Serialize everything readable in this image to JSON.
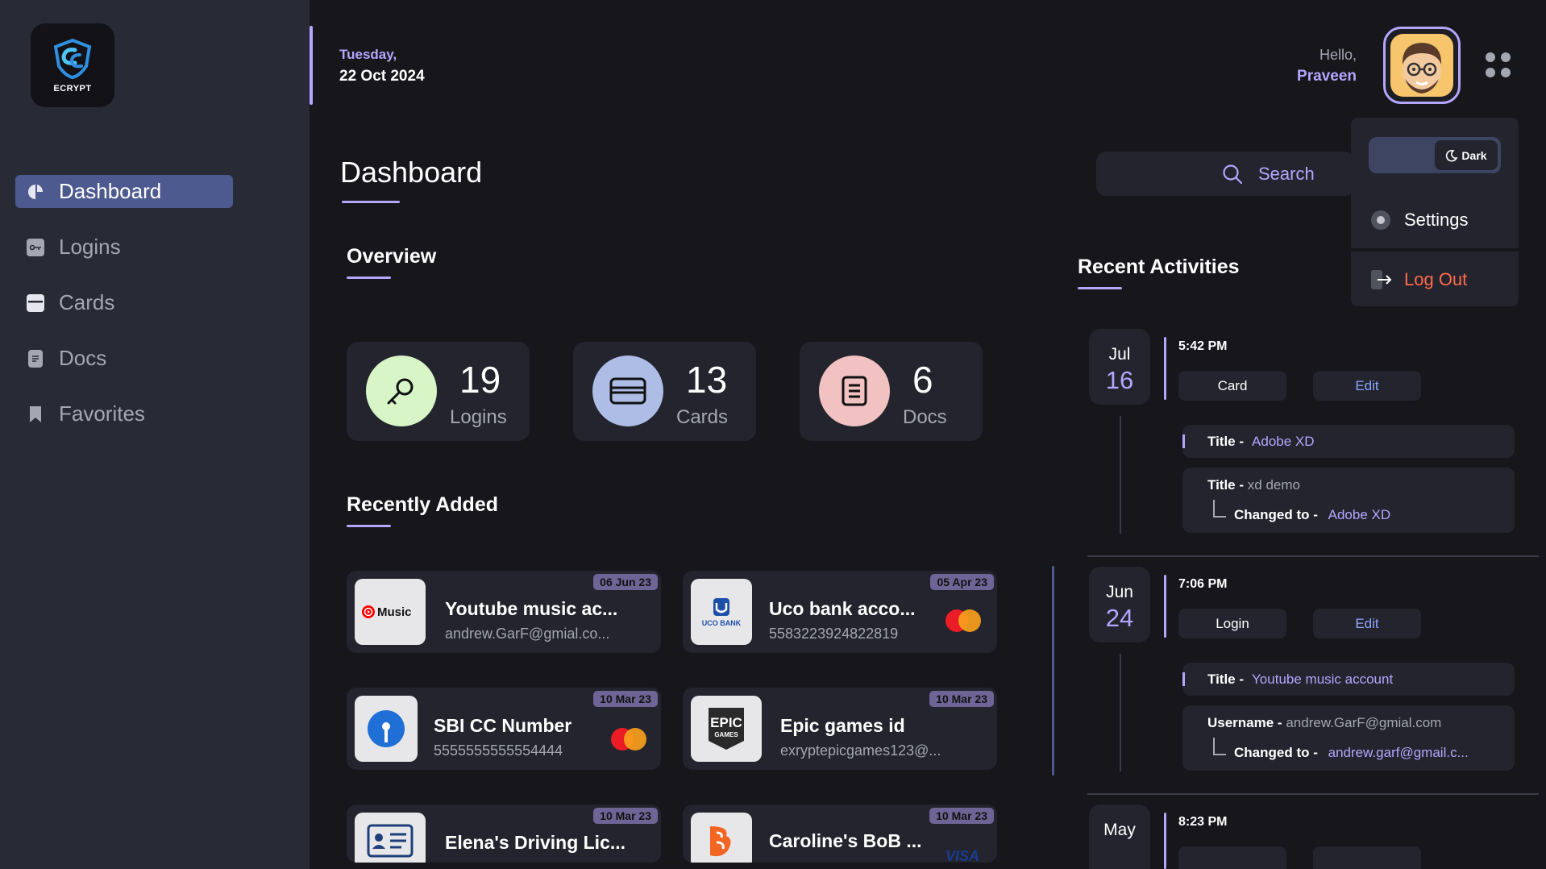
{
  "app": {
    "logo_text": "ECRYPT"
  },
  "sidebar": {
    "items": [
      {
        "label": "Dashboard",
        "icon": "dashboard-icon",
        "active": true
      },
      {
        "label": "Logins",
        "icon": "key-icon"
      },
      {
        "label": "Cards",
        "icon": "card-icon"
      },
      {
        "label": "Docs",
        "icon": "doc-icon"
      },
      {
        "label": "Favorites",
        "icon": "bookmark-icon"
      }
    ]
  },
  "header": {
    "day": "Tuesday,",
    "date": "22 Oct 2024",
    "greeting": "Hello,",
    "user_name": "Praveen"
  },
  "page_title": "Dashboard",
  "search": {
    "label": "Search"
  },
  "dropdown": {
    "theme_label": "Dark",
    "settings_label": "Settings",
    "logout_label": "Log Out"
  },
  "overview": {
    "title": "Overview",
    "stats": [
      {
        "value": "19",
        "label": "Logins",
        "color": "#d7f5c6"
      },
      {
        "value": "13",
        "label": "Cards",
        "color": "#aebde6"
      },
      {
        "value": "6",
        "label": "Docs",
        "color": "#f2c1c1"
      }
    ]
  },
  "recently_added": {
    "title": "Recently Added",
    "items": [
      {
        "title": "Youtube music ac...",
        "sub": "andrew.GarF@gmial.co...",
        "date": "06 Jun 23",
        "thumb": "Music"
      },
      {
        "title": "Uco bank acco...",
        "sub": "5583223924822819",
        "date": "05 Apr 23",
        "thumb": "UCO BANK"
      },
      {
        "title": "SBI CC Number",
        "sub": "5555555555554444",
        "date": "10 Mar 23",
        "thumb": ""
      },
      {
        "title": "Epic games id",
        "sub": "exryptepicgames123@...",
        "date": "10 Mar 23",
        "thumb": "EPIC GAMES"
      },
      {
        "title": "Elena's Driving Lic...",
        "sub": "",
        "date": "10 Mar 23",
        "thumb": ""
      },
      {
        "title": "Caroline's BoB ...",
        "sub": "",
        "date": "10 Mar 23",
        "thumb": ""
      }
    ],
    "card_network_last": "VISA"
  },
  "recent_activities": {
    "title": "Recent Activities",
    "entries": [
      {
        "month": "Jul",
        "day": "16",
        "time": "5:42 PM",
        "type": "Card",
        "action": "Edit",
        "title_label": "Title -",
        "title_value": "Adobe XD",
        "field_label": "Title -",
        "field_old": "xd demo",
        "changed_label": "Changed to -",
        "changed_value": "Adobe XD"
      },
      {
        "month": "Jun",
        "day": "24",
        "time": "7:06 PM",
        "type": "Login",
        "action": "Edit",
        "title_label": "Title -",
        "title_value": "Youtube music account",
        "field_label": "Username -",
        "field_old": "andrew.GarF@gmial.com",
        "changed_label": "Changed to -",
        "changed_value": "andrew.garf@gmail.c..."
      },
      {
        "month": "May",
        "time": "8:23 PM"
      }
    ]
  },
  "colors": {
    "accent": "#b4a6ff",
    "sidebar_bg": "#282a36",
    "page_bg": "#16161b",
    "card_bg": "#23242d",
    "active_nav": "#4d5a8f",
    "logout": "#ff6b4a"
  }
}
